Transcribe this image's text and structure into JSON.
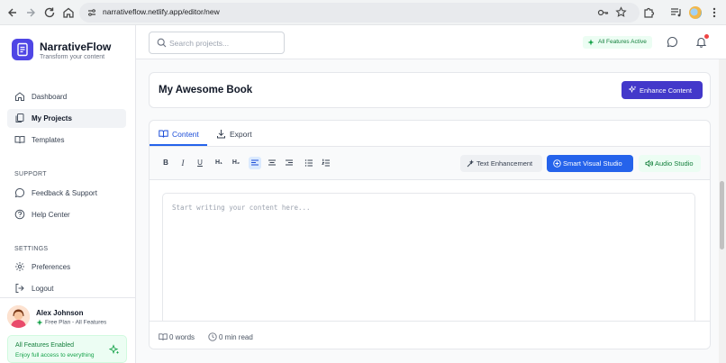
{
  "browser": {
    "url": "narrativeflow.netlify.app/editor/new"
  },
  "sidebar": {
    "brand": "NarrativeFlow",
    "tagline": "Transform your content",
    "nav": [
      {
        "label": "Dashboard",
        "icon": "home-icon"
      },
      {
        "label": "My Projects",
        "icon": "files-icon",
        "active": true
      },
      {
        "label": "Templates",
        "icon": "book-icon"
      }
    ],
    "support_title": "SUPPORT",
    "support": [
      {
        "label": "Feedback & Support",
        "icon": "message-icon"
      },
      {
        "label": "Help Center",
        "icon": "help-circle-icon"
      }
    ],
    "settings_title": "SETTINGS",
    "settings": [
      {
        "label": "Preferences",
        "icon": "gear-icon"
      },
      {
        "label": "Logout",
        "icon": "logout-icon"
      }
    ],
    "user": {
      "name": "Alex Johnson",
      "plan": "Free Plan - All Features"
    },
    "features_box": {
      "title": "All Features Enabled",
      "subtitle": "Enjoy full access to everything"
    }
  },
  "topbar": {
    "search_placeholder": "Search projects...",
    "badge": "All Features Active"
  },
  "title_card": {
    "title": "My Awesome Book",
    "enhance_label": "Enhance Content"
  },
  "editor": {
    "tabs": [
      {
        "label": "Content",
        "active": true
      },
      {
        "label": "Export"
      }
    ],
    "format_buttons": [
      "bold",
      "italic",
      "underline",
      "H1",
      "H2",
      "align-left",
      "align-center",
      "align-right",
      "bullet-list",
      "ordered-list"
    ],
    "text_enhancement_label": "Text Enhancement",
    "smart_visual_label": "Smart Visual Studio",
    "audio_studio_label": "Audio Studio",
    "placeholder": "Start writing your content here...",
    "words": "0 words",
    "read_time": "0 min read"
  },
  "colors": {
    "accent": "#4338ca",
    "primary_blue": "#2563eb",
    "success": "#16a34a"
  }
}
